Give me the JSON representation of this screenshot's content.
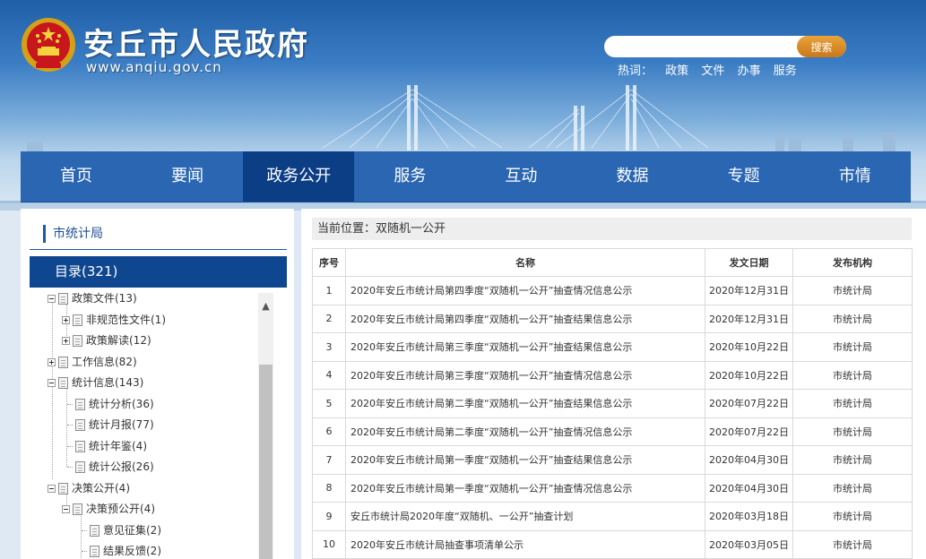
{
  "header": {
    "site_title": "安丘市人民政府",
    "site_domain": "www.anqiu.gov.cn",
    "search": {
      "placeholder": "",
      "button_label": "搜索"
    },
    "hot_words": {
      "label": "热词：",
      "items": [
        "政策",
        "文件",
        "办事",
        "服务"
      ]
    }
  },
  "nav": {
    "items": [
      "首页",
      "要闻",
      "政务公开",
      "服务",
      "互动",
      "数据",
      "专题",
      "市情"
    ],
    "active_index": 2
  },
  "sidebar": {
    "title": "市统计局",
    "catalog_label": "目录(321)",
    "tree": [
      {
        "label": "政策文件(13)",
        "level": 0,
        "toggle": "minus"
      },
      {
        "label": "非规范性文件(1)",
        "level": 1,
        "toggle": "plus"
      },
      {
        "label": "政策解读(12)",
        "level": 1,
        "toggle": "plus"
      },
      {
        "label": "工作信息(82)",
        "level": 0,
        "toggle": "plus"
      },
      {
        "label": "统计信息(143)",
        "level": 0,
        "toggle": "minus"
      },
      {
        "label": "统计分析(36)",
        "level": 1,
        "toggle": "none"
      },
      {
        "label": "统计月报(77)",
        "level": 1,
        "toggle": "none"
      },
      {
        "label": "统计年鉴(4)",
        "level": 1,
        "toggle": "none"
      },
      {
        "label": "统计公报(26)",
        "level": 1,
        "toggle": "none"
      },
      {
        "label": "决策公开(4)",
        "level": 0,
        "toggle": "minus"
      },
      {
        "label": "决策预公开(4)",
        "level": 1,
        "toggle": "minus"
      },
      {
        "label": "意见征集(2)",
        "level": 2,
        "toggle": "none"
      },
      {
        "label": "结果反馈(2)",
        "level": 2,
        "toggle": "none"
      }
    ]
  },
  "main": {
    "breadcrumb": "当前位置：双随机一公开",
    "table": {
      "headers": [
        "序号",
        "名称",
        "发文日期",
        "发布机构"
      ],
      "rows": [
        [
          "1",
          "2020年安丘市统计局第四季度“双随机一公开”抽查情况信息公示",
          "2020年12月31日",
          "市统计局"
        ],
        [
          "2",
          "2020年安丘市统计局第四季度“双随机一公开”抽查结果信息公示",
          "2020年12月31日",
          "市统计局"
        ],
        [
          "3",
          "2020年安丘市统计局第三季度“双随机一公开”抽查结果信息公示",
          "2020年10月22日",
          "市统计局"
        ],
        [
          "4",
          "2020年安丘市统计局第三季度“双随机一公开”抽查情况信息公示",
          "2020年10月22日",
          "市统计局"
        ],
        [
          "5",
          "2020年安丘市统计局第二季度“双随机一公开”抽查结果信息公示",
          "2020年07月22日",
          "市统计局"
        ],
        [
          "6",
          "2020年安丘市统计局第二季度“双随机一公开”抽查情况信息公示",
          "2020年07月22日",
          "市统计局"
        ],
        [
          "7",
          "2020年安丘市统计局第一季度“双随机一公开”抽查结果信息公示",
          "2020年04月30日",
          "市统计局"
        ],
        [
          "8",
          "2020年安丘市统计局第一季度“双随机一公开”抽查情况信息公示",
          "2020年04月30日",
          "市统计局"
        ],
        [
          "9",
          "安丘市统计局2020年度“双随机、一公开”抽查计划",
          "2020年03月18日",
          "市统计局"
        ],
        [
          "10",
          "2020年安丘市统计局抽查事项清单公示",
          "2020年03月05日",
          "市统计局"
        ]
      ]
    }
  },
  "colors": {
    "nav_bg": "#2a66b2",
    "nav_active": "#0c3e86",
    "catalog_bar": "#0f4690",
    "search_button": "#d98a28"
  }
}
